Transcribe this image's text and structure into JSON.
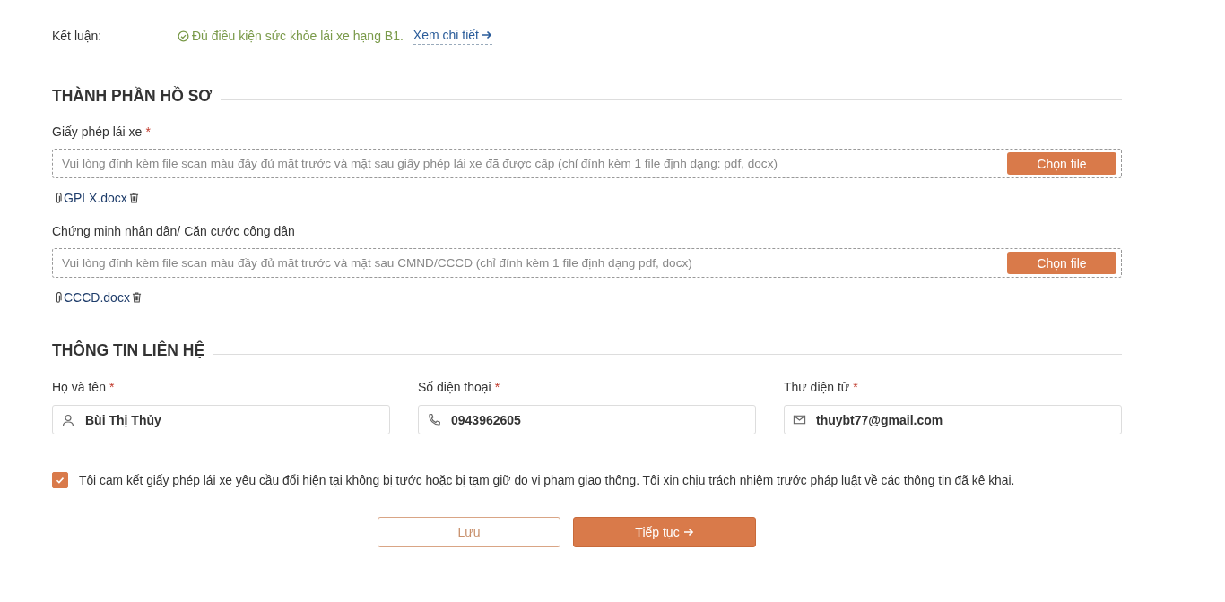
{
  "conclusion": {
    "label": "Kết luận:",
    "status": "Đủ điều kiện sức khỏe lái xe hạng B1.",
    "link": "Xem chi tiết"
  },
  "documents": {
    "title": "THÀNH PHẦN HỒ SƠ",
    "items": [
      {
        "label": "Giấy phép lái xe",
        "required": true,
        "placeholder": "Vui lòng đính kèm file scan màu đầy đủ mặt trước và mặt sau giấy phép lái xe đã được cấp (chỉ đính kèm 1 file định dạng: pdf, docx)",
        "button": "Chọn file",
        "file": "GPLX.docx"
      },
      {
        "label": "Chứng minh nhân dân/ Căn cước công dân",
        "required": false,
        "placeholder": "Vui lòng đính kèm file scan màu đầy đủ mặt trước và mặt sau CMND/CCCD (chỉ đính kèm 1 file định dạng pdf, docx)",
        "button": "Chọn file",
        "file": "CCCD.docx"
      }
    ]
  },
  "contact": {
    "title": "THÔNG TIN LIÊN HỆ",
    "fields": [
      {
        "kind": "user",
        "label": "Họ và tên",
        "required": true,
        "value": "Bùi Thị Thủy"
      },
      {
        "kind": "phone",
        "label": "Số điện thoại",
        "required": true,
        "value": "0943962605"
      },
      {
        "kind": "mail",
        "label": "Thư điện tử",
        "required": true,
        "value": "thuybt77@gmail.com"
      }
    ]
  },
  "agreement": {
    "checked": true,
    "text": "Tôi cam kết giấy phép lái xe yêu cầu đổi hiện tại không bị tước hoặc bị tạm giữ do vi phạm giao thông. Tôi xin chịu trách nhiệm trước pháp luật về các thông tin đã kê khai."
  },
  "buttons": [
    {
      "kind": "secondary",
      "label": "Lưu"
    },
    {
      "kind": "primary",
      "label": "Tiếp tục"
    }
  ],
  "required_mark": "*"
}
